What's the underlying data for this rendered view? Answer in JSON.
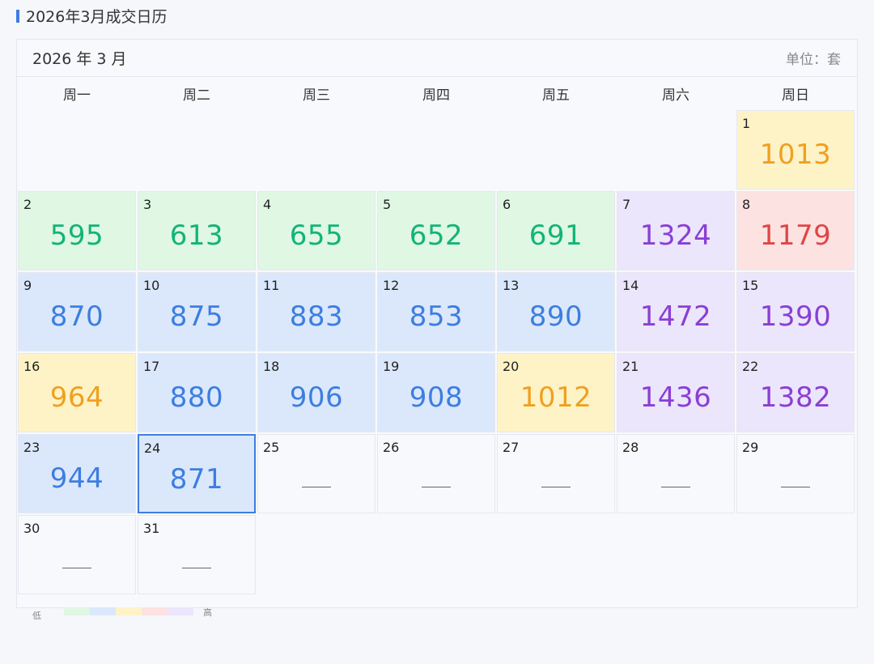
{
  "title": "2026年3月成交日历",
  "calendar": {
    "month_label": "2026 年 3 月",
    "unit_label": "单位：套",
    "weekdays": [
      "周一",
      "周二",
      "周三",
      "周四",
      "周五",
      "周六",
      "周日"
    ],
    "leading_blanks": 6,
    "days": [
      {
        "day": "1",
        "value": "1013",
        "level": "yellow"
      },
      {
        "day": "2",
        "value": "595",
        "level": "green"
      },
      {
        "day": "3",
        "value": "613",
        "level": "green"
      },
      {
        "day": "4",
        "value": "655",
        "level": "green"
      },
      {
        "day": "5",
        "value": "652",
        "level": "green"
      },
      {
        "day": "6",
        "value": "691",
        "level": "green"
      },
      {
        "day": "7",
        "value": "1324",
        "level": "purple"
      },
      {
        "day": "8",
        "value": "1179",
        "level": "red"
      },
      {
        "day": "9",
        "value": "870",
        "level": "blue"
      },
      {
        "day": "10",
        "value": "875",
        "level": "blue"
      },
      {
        "day": "11",
        "value": "883",
        "level": "blue"
      },
      {
        "day": "12",
        "value": "853",
        "level": "blue"
      },
      {
        "day": "13",
        "value": "890",
        "level": "blue"
      },
      {
        "day": "14",
        "value": "1472",
        "level": "purple"
      },
      {
        "day": "15",
        "value": "1390",
        "level": "purple"
      },
      {
        "day": "16",
        "value": "964",
        "level": "yellow"
      },
      {
        "day": "17",
        "value": "880",
        "level": "blue"
      },
      {
        "day": "18",
        "value": "906",
        "level": "blue"
      },
      {
        "day": "19",
        "value": "908",
        "level": "blue"
      },
      {
        "day": "20",
        "value": "1012",
        "level": "yellow"
      },
      {
        "day": "21",
        "value": "1436",
        "level": "purple"
      },
      {
        "day": "22",
        "value": "1382",
        "level": "purple"
      },
      {
        "day": "23",
        "value": "944",
        "level": "blue"
      },
      {
        "day": "24",
        "value": "871",
        "level": "blue",
        "selected": true
      },
      {
        "day": "25",
        "value": null,
        "level": "none"
      },
      {
        "day": "26",
        "value": null,
        "level": "none"
      },
      {
        "day": "27",
        "value": null,
        "level": "none"
      },
      {
        "day": "28",
        "value": null,
        "level": "none"
      },
      {
        "day": "29",
        "value": null,
        "level": "none"
      },
      {
        "day": "30",
        "value": null,
        "level": "none"
      },
      {
        "day": "31",
        "value": null,
        "level": "none"
      }
    ]
  },
  "legend": {
    "low_label": "低",
    "high_label": "高",
    "colors": [
      "#dff7e3",
      "#dbe8fb",
      "#fef3c7",
      "#fde2e2",
      "#ebe6fb"
    ]
  },
  "colors": {
    "accent": "#3d7ee0",
    "green": "#12b478",
    "blue": "#3d7ee0",
    "yellow": "#f0a020",
    "red": "#e04646",
    "purple": "#8a3fd4"
  }
}
